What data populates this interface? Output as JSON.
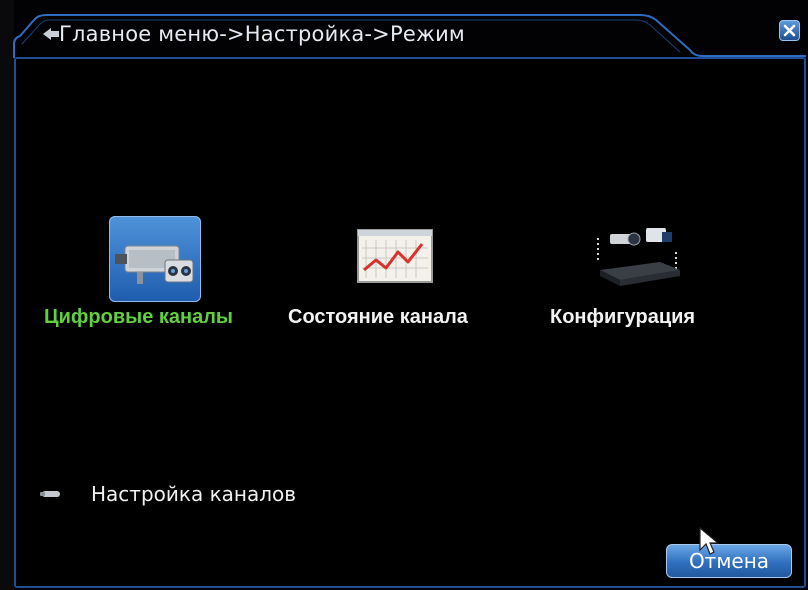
{
  "window": {
    "breadcrumb": "Главное меню->Настройка->Режим",
    "close_icon": "close-x-icon"
  },
  "menu": {
    "items": [
      {
        "label": "Цифровые каналы",
        "icon": "camera-icon",
        "selected": true
      },
      {
        "label": "Состояние канала",
        "icon": "chart-icon",
        "selected": false
      },
      {
        "label": "Конфигурация",
        "icon": "devices-config-icon",
        "selected": false
      }
    ]
  },
  "sub_items": [
    {
      "label": "Настройка каналов",
      "icon": "bullet-icon"
    }
  ],
  "buttons": {
    "cancel": "Отмена"
  },
  "colors": {
    "accent_blue": "#1f4e95",
    "selected_label": "#62cf3e",
    "text": "#f2f2f2"
  }
}
